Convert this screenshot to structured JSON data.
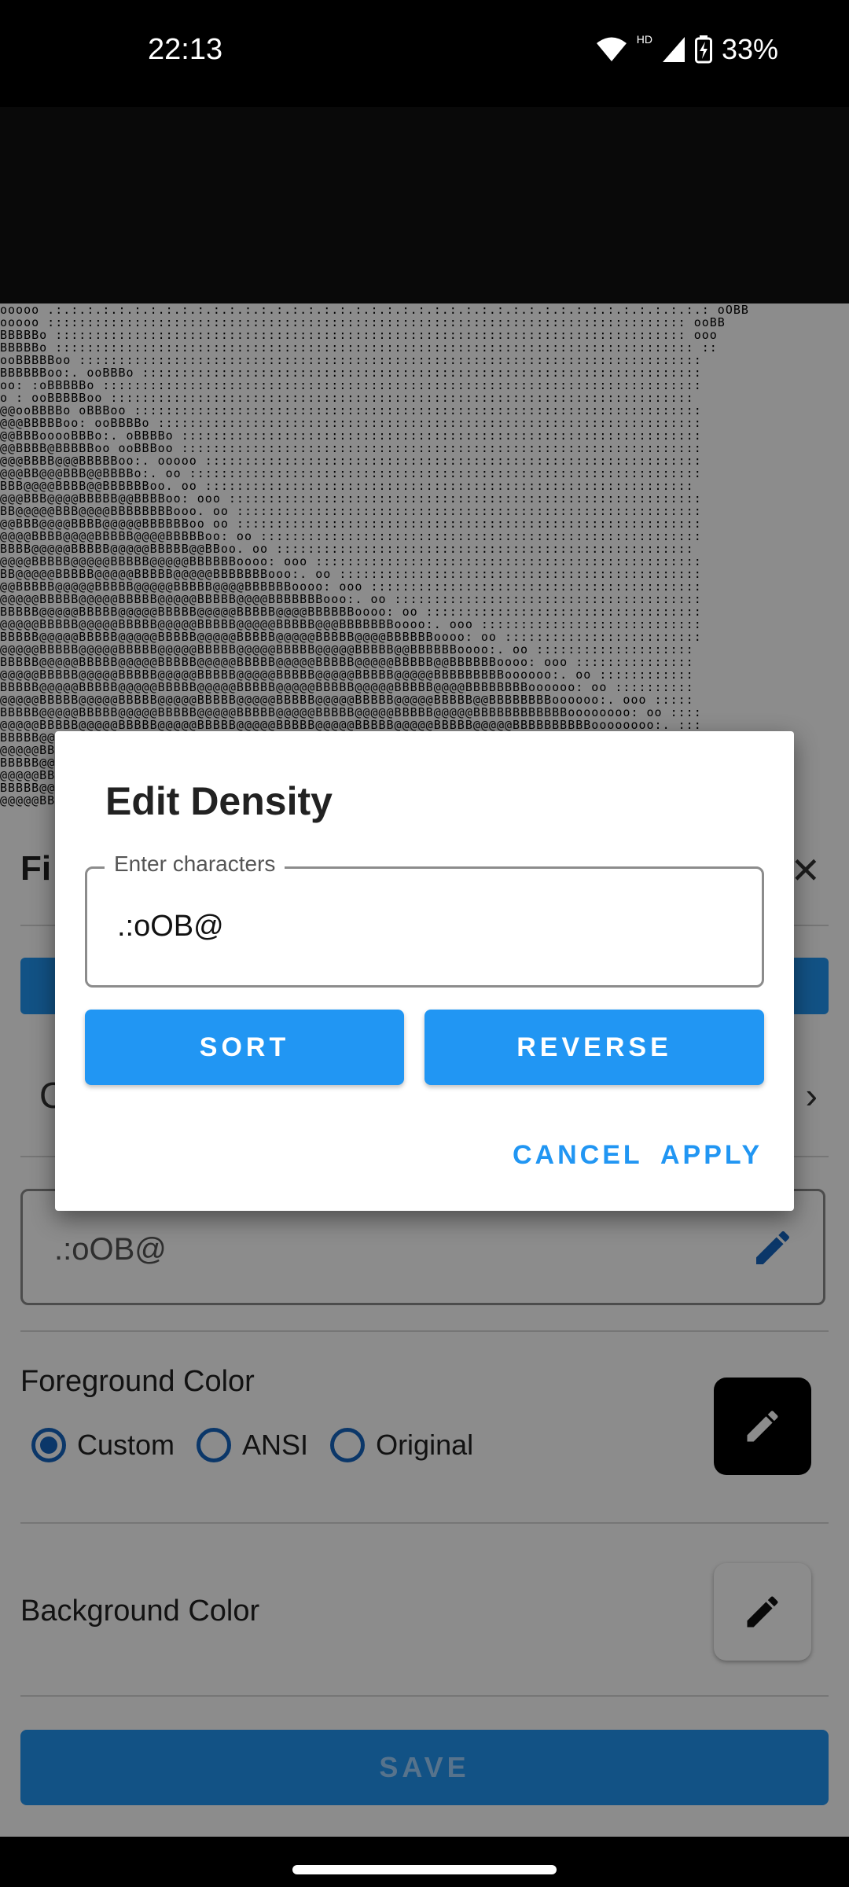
{
  "status_bar": {
    "time": "22:13",
    "network_badge": "HD",
    "battery": "33%",
    "icons": [
      "wifi-icon",
      "cellular-signal-icon",
      "battery-charging-icon"
    ]
  },
  "preview": {
    "ascii_art": "ooooo .:.:.:.:.:.:.:.:.:.:.:.:.:.:.:.:.:.:.:.:.:.:.:.:.:.:.:.:.:.:.:.:.:.:.:.:.:.:.:.:.:.: oOBB\nooooo ::::::::::::::::::::::::::::::::::::::::::::::::::::::::::::::::::::::::::::::::: ooBB\nBBBBBo :::::::::::::::::::::::::::::::::::::::::::::::::::::::::::::::::::::::::::::::: ooo\nBBBBBo ::::::::::::::::::::::::::::::::::::::::::::::::::::::::::::::::::::::::::::::::: ::\nooBBBBBoo :::::::::::::::::::::::::::::::::::::::::::::::::::::::::::::::::::::::::::::::\nBBBBBBoo:. ooBBBo :::::::::::::::::::::::::::::::::::::::::::::::::::::::::::::::::::::::\noo: :oBBBBBo ::::::::::::::::::::::::::::::::::::::::::::::::::::::::::::::::::::::::::::\no : ooBBBBBoo ::::::::::::::::::::::::::::::::::::::::::::::::::::::::::::::::::::::::::\n@@ooBBBBo oBBBoo ::::::::::::::::::::::::::::::::::::::::::::::::::::::::::::::::::::::::\n@@@BBBBBoo: ooBBBBo :::::::::::::::::::::::::::::::::::::::::::::::::::::::::::::::::::::\n@@BBBooooBBBo:. oBBBBo ::::::::::::::::::::::::::::::::::::::::::::::::::::::::::::::::::\n@@BBBB@BBBBBoo ooBBBoo ::::::::::::::::::::::::::::::::::::::::::::::::::::::::::::::::::\n@@@BBBB@@@BBBBBoo:. ooooo :::::::::::::::::::::::::::::::::::::::::::::::::::::::::::::::\n@@@BB@@@BBB@@BBBBo:. oo :::::::::::::::::::::::::::::::::::::::::::::::::::::::::::::::::\nBBB@@@@BBBB@@BBBBBBoo. oo ::::::::::::::::::::::::::::::::::::::::::::::::::::::::::::::\n@@@BBB@@@@BBBBB@@BBBBoo: ooo ::::::::::::::::::::::::::::::::::::::::::::::::::::::::::::\nBB@@@@@BBB@@@@BBBBBBBBooo. oo :::::::::::::::::::::::::::::::::::::::::::::::::::::::::::\n@@BBB@@@@BBBB@@@@@BBBBBBoo oo :::::::::::::::::::::::::::::::::::::::::::::::::::::::::::\n@@@@BBBB@@@@BBBBB@@@@BBBBBoo: oo ::::::::::::::::::::::::::::::::::::::::::::::::::::::::\nBBBB@@@@@BBBBB@@@@@BBBBB@@BBoo. oo :::::::::::::::::::::::::::::::::::::::::::::::::::::\n@@@@BBBBB@@@@@BBBBB@@@@@BBBBBBoooo: ooo :::::::::::::::::::::::::::::::::::::::::::::::::\nBB@@@@@BBBBB@@@@@BBBBB@@@@@BBBBBBBooo:. oo ::::::::::::::::::::::::::::::::::::::::::::::\n@@BBBBB@@@@@BBBBB@@@@@BBBBB@@@@BBBBBBoooo: ooo ::::::::::::::::::::::::::::::::::::::::::\n@@@@@BBBBB@@@@@BBBBB@@@@@BBBBB@@@@BBBBBBBooo:. oo :::::::::::::::::::::::::::::::::::::::\nBBBBB@@@@@BBBBB@@@@@BBBBB@@@@@BBBBB@@@@BBBBBBoooo: oo :::::::::::::::::::::::::::::::::::\n@@@@@BBBBB@@@@@BBBBB@@@@@BBBBB@@@@@BBBBB@@@BBBBBBBoooo:. ooo ::::::::::::::::::::::::::::\nBBBBB@@@@@BBBBB@@@@@BBBBB@@@@@BBBBB@@@@@BBBBB@@@@BBBBBBoooo: oo :::::::::::::::::::::::::\n@@@@@BBBBB@@@@@BBBBB@@@@@BBBBB@@@@@BBBBB@@@@@BBBBB@@BBBBBBoooo:. oo ::::::::::::::::::::\nBBBBB@@@@@BBBBB@@@@@BBBBB@@@@@BBBBB@@@@@BBBBB@@@@@BBBBB@@BBBBBBoooo: ooo :::::::::::::::\n@@@@@BBBBB@@@@@BBBBB@@@@@BBBBB@@@@@BBBBB@@@@@BBBBB@@@@@BBBBBBBBBoooooo:. oo ::::::::::::\nBBBBB@@@@@BBBBB@@@@@BBBBB@@@@@BBBBB@@@@@BBBBB@@@@@BBBBB@@@@BBBBBBBBoooooo: oo ::::::::::\n@@@@@BBBBB@@@@@BBBBB@@@@@BBBBB@@@@@BBBBB@@@@@BBBBB@@@@@BBBBB@@BBBBBBBBoooooo:. ooo :::::\nBBBBB@@@@@BBBBB@@@@@BBBBB@@@@@BBBBB@@@@@BBBBB@@@@@BBBBB@@@@@BBBBBBBBBBBBoooooooo: oo ::::\n@@@@@BBBBB@@@@@BBBBB@@@@@BBBBB@@@@@BBBBB@@@@@BBBBB@@@@@BBBBB@@@@@BBBBBBBBBBoooooooo:. :::\nBBBBB@@@@@BBBBB@@@@@BBBBB@@@@@BBBBB@@@@@BBBBB@@@@@BBBBB@@@@@BBBBB@@@@BBBBBBBBBoooooooo:::\n@@@@@BBBBB@@@@@BBBBB@@@@@BBBBB@@@@@BBBBB@@@@@BBBBB@@@@@BBBBB@@@@@BBBBB@@BBBBBBBBoooooooo:\nBBBBB@@@@@BBBBB@@@@@BBBBB@@@@@BBBBB@@@@@BBBBB@@@@@BBBBB@@@@@BBBBB@@@@@BBBBBBBBBBBBoooooo:\n@@@@@BBBBB@@@@@BBBBB@@@@@BBBBB@@@@@BBBBB@@@@@BBBBB@@@@@BBBBB@@@@@BBBBB@@@@@BBBBBBBBBooooo\nBBBBB@@@@@BBBBB@@@@@BBBBB@@@@@BBBBB@@@@@BBBBB@@@@@BBBBB@@@@@BBBBB@@@@@BBBBB@@@BBBBBBBoooo\n@@@@@BBBBB@@@@@BBBBB@@@@@BBBBB@@@@@BBBBB@@@@@BBBBB@@@@@BBBBB@@@@@BBBBB@@@@@BBBBB@BBBBBBoo"
  },
  "panel": {
    "title_fragment": "Fi",
    "row_letter": "C",
    "density_value": ".:oOB@",
    "foreground_title": "Foreground Color",
    "color_options": [
      {
        "label": "Custom",
        "selected": true
      },
      {
        "label": "ANSI",
        "selected": false
      },
      {
        "label": "Original",
        "selected": false
      }
    ],
    "foreground_color": "#000000",
    "background_title": "Background Color",
    "background_color": "#ffffff",
    "save_label": "SAVE"
  },
  "dialog": {
    "title": "Edit Density",
    "input_label": "Enter characters",
    "input_value": ".:oOB@",
    "sort_label": "SORT",
    "reverse_label": "REVERSE",
    "cancel_label": "CANCEL",
    "apply_label": "APPLY",
    "accent_color": "#2196f3"
  }
}
